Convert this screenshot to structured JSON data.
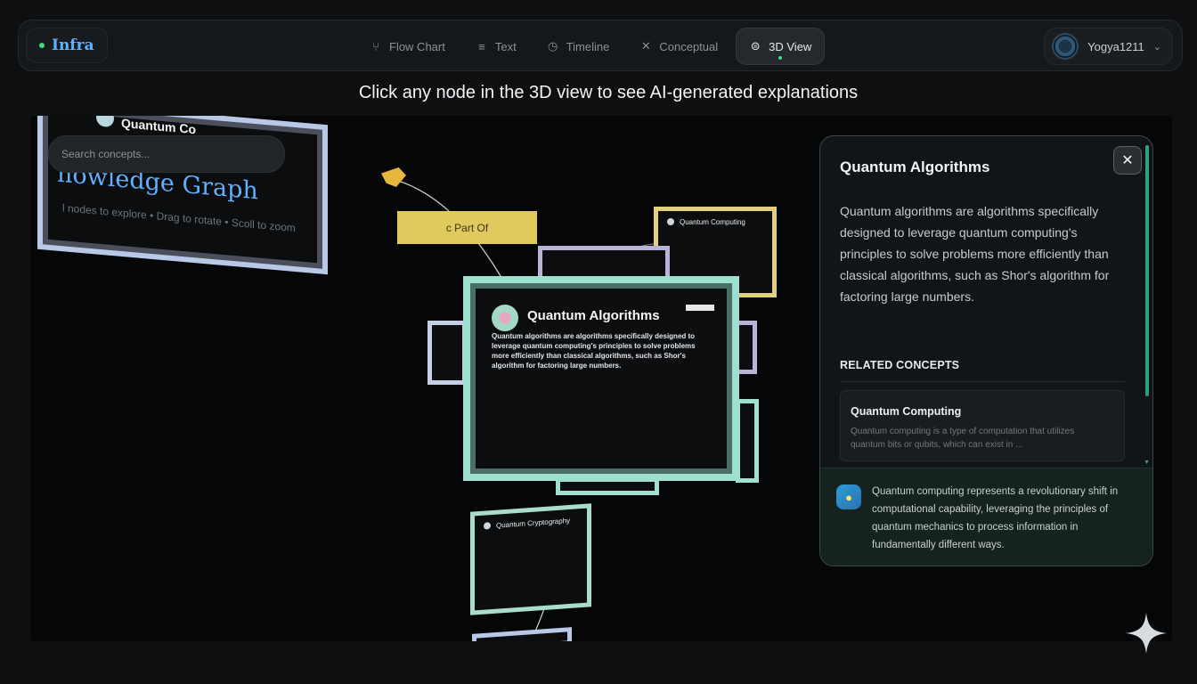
{
  "app": {
    "brand": "Infra"
  },
  "nav": {
    "items": [
      {
        "label": "Flow Chart",
        "icon": "flow-chart-icon",
        "glyph": "⑂"
      },
      {
        "label": "Text",
        "icon": "text-icon",
        "glyph": "≡"
      },
      {
        "label": "Timeline",
        "icon": "clock-icon",
        "glyph": "◷"
      },
      {
        "label": "Conceptual",
        "icon": "conceptual-icon",
        "glyph": "✕"
      },
      {
        "label": "3D View",
        "icon": "cube-icon",
        "glyph": "⊜"
      }
    ],
    "active_index": 4
  },
  "user": {
    "name": "Yogya1211"
  },
  "hint": "Click any node in the 3D view to see AI-generated explanations",
  "graph": {
    "header_node_title": "Quantum Co",
    "search_placeholder": "Search concepts...",
    "title": "nowledge Graph",
    "subtitle": "l nodes to explore • Drag to rotate • Scoll to zoom",
    "edge_label": "c Part Of",
    "main_node": {
      "title": "Quantum Algorithms",
      "description": "Quantum algorithms are algorithms specifically designed to leverage quantum computing's principles to solve problems more efficiently than classical algorithms, such as Shor's algorithm for factoring large numbers."
    },
    "mini_nodes": [
      {
        "title": "Quantum Computing"
      },
      {
        "title": "Quantum Cryptography"
      }
    ]
  },
  "panel": {
    "title": "Quantum Algorithms",
    "close_label": "✕",
    "description": "Quantum algorithms are algorithms specifically designed to leverage quantum computing's principles to solve problems more efficiently than classical algorithms, such as Shor's algorithm for factoring large numbers.",
    "related_heading": "RELATED CONCEPTS",
    "related": [
      {
        "title": "Quantum Computing",
        "description": "Quantum computing is a type of computation that utilizes quantum bits or qubits, which can exist in ..."
      }
    ],
    "ai_insight": "Quantum computing represents a revolutionary shift in computational capability, leveraging the principles of quantum mechanics to process information in fundamentally different ways."
  },
  "colors": {
    "accent_green": "#3ddc84",
    "brand_blue": "#5fb0ff",
    "node_teal": "#9ee0cf",
    "node_yellow": "#e0c95d",
    "node_lavender": "#b8b3d8"
  }
}
